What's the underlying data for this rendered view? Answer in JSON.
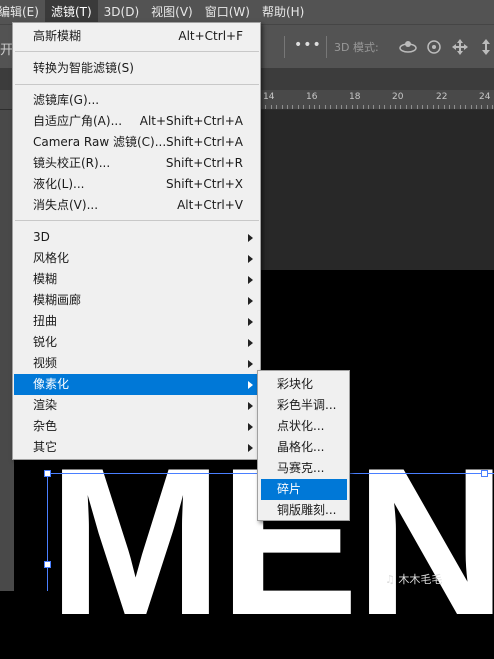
{
  "menubar": {
    "items": [
      {
        "label": "编辑(E)"
      },
      {
        "label": "滤镜(T)",
        "active": true
      },
      {
        "label": "3D(D)"
      },
      {
        "label": "视图(V)"
      },
      {
        "label": "窗口(W)"
      },
      {
        "label": "帮助(H)"
      }
    ]
  },
  "options_bar": {
    "left_glyph": "开",
    "more_label": "•••",
    "mode_label": "3D 模式:"
  },
  "ruler": {
    "labels": [
      "14",
      "16",
      "18",
      "20",
      "22",
      "24"
    ]
  },
  "filter_menu": {
    "items": [
      {
        "label": "高斯模糊",
        "shortcut": "Alt+Ctrl+F"
      },
      {
        "label": "转换为智能滤镜(S)",
        "shortcut": ""
      },
      {
        "label": "滤镜库(G)...",
        "shortcut": ""
      },
      {
        "label": "自适应广角(A)...",
        "shortcut": "Alt+Shift+Ctrl+A"
      },
      {
        "label": "Camera Raw 滤镜(C)...",
        "shortcut": "Shift+Ctrl+A"
      },
      {
        "label": "镜头校正(R)...",
        "shortcut": "Shift+Ctrl+R"
      },
      {
        "label": "液化(L)...",
        "shortcut": "Shift+Ctrl+X"
      },
      {
        "label": "消失点(V)...",
        "shortcut": "Alt+Ctrl+V"
      },
      {
        "label": "3D",
        "submenu": true
      },
      {
        "label": "风格化",
        "submenu": true
      },
      {
        "label": "模糊",
        "submenu": true
      },
      {
        "label": "模糊画廊",
        "submenu": true
      },
      {
        "label": "扭曲",
        "submenu": true
      },
      {
        "label": "锐化",
        "submenu": true
      },
      {
        "label": "视频",
        "submenu": true
      },
      {
        "label": "像素化",
        "submenu": true,
        "highlighted": true
      },
      {
        "label": "渲染",
        "submenu": true
      },
      {
        "label": "杂色",
        "submenu": true
      },
      {
        "label": "其它",
        "submenu": true
      }
    ]
  },
  "pixelate_submenu": {
    "items": [
      {
        "label": "彩块化"
      },
      {
        "label": "彩色半调..."
      },
      {
        "label": "点状化..."
      },
      {
        "label": "晶格化..."
      },
      {
        "label": "马赛克..."
      },
      {
        "label": "碎片",
        "highlighted": true
      },
      {
        "label": "铜版雕刻..."
      }
    ]
  },
  "canvas": {
    "text": "MEN"
  },
  "watermark": {
    "text": "木木毛毛"
  },
  "colors": {
    "menu_bg": "#f0f0f0",
    "highlight": "#0078d7",
    "app_chrome": "#535353",
    "transform_box": "#4a7fff"
  }
}
